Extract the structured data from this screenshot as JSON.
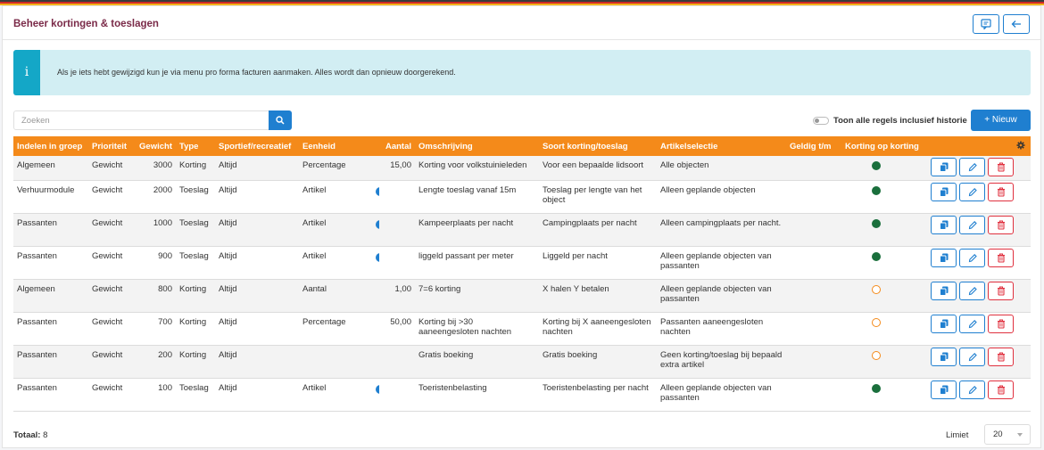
{
  "page": {
    "title": "Beheer kortingen & toeslagen",
    "header_icons": [
      "comment-icon",
      "arrow-left-icon"
    ]
  },
  "alert": {
    "icon": "i",
    "text": "Als je iets hebt gewijzigd kun je via menu pro forma facturen aanmaken. Alles wordt dan opnieuw doorgerekend."
  },
  "toolbar": {
    "search_placeholder": "Zoeken",
    "search_value": "",
    "toggle_label": "Toon alle regels inclusief historie",
    "toggle_on": false,
    "new_label": "+ Nieuw"
  },
  "table": {
    "columns": [
      "Indelen in groep",
      "Prioriteit",
      "Gewicht",
      "Type",
      "Sportief/recreatief",
      "Eenheid",
      "",
      "Aantal",
      "Omschrijving",
      "Soort korting/toeslag",
      "Artikelselectie",
      "Geldig t/m",
      "Korting op korting",
      ""
    ],
    "rows": [
      {
        "groep": "Algemeen",
        "prioriteit": "Gewicht",
        "gewicht": "3000",
        "type": "Korting",
        "sport": "Altijd",
        "eenheid": "Percentage",
        "info": false,
        "aantal": "15,00",
        "omschrijving": "Korting voor volkstuinieleden",
        "soort": "Voor een bepaalde lidsoort",
        "artikel": "Alle objecten",
        "geldig": "",
        "kok": true
      },
      {
        "groep": "Verhuurmodule",
        "prioriteit": "Gewicht",
        "gewicht": "2000",
        "type": "Toeslag",
        "sport": "Altijd",
        "eenheid": "Artikel",
        "info": true,
        "aantal": "",
        "omschrijving": "Lengte toeslag vanaf 15m",
        "soort": "Toeslag per lengte van het object",
        "artikel": "Alleen geplande objecten",
        "geldig": "",
        "kok": true
      },
      {
        "groep": "Passanten",
        "prioriteit": "Gewicht",
        "gewicht": "1000",
        "type": "Toeslag",
        "sport": "Altijd",
        "eenheid": "Artikel",
        "info": true,
        "aantal": "",
        "omschrijving": "Kampeerplaats per nacht",
        "soort": "Campingplaats per nacht",
        "artikel": "Alleen campingplaats per nacht.",
        "geldig": "",
        "kok": true
      },
      {
        "groep": "Passanten",
        "prioriteit": "Gewicht",
        "gewicht": "900",
        "type": "Toeslag",
        "sport": "Altijd",
        "eenheid": "Artikel",
        "info": true,
        "aantal": "",
        "omschrijving": "liggeld passant per meter",
        "soort": "Liggeld per nacht",
        "artikel": "Alleen geplande objecten van passanten",
        "geldig": "",
        "kok": true
      },
      {
        "groep": "Algemeen",
        "prioriteit": "Gewicht",
        "gewicht": "800",
        "type": "Korting",
        "sport": "Altijd",
        "eenheid": "Aantal",
        "info": false,
        "aantal": "1,00",
        "omschrijving": "7=6 korting",
        "soort": "X halen Y betalen",
        "artikel": "Alleen geplande objecten van passanten",
        "geldig": "",
        "kok": false
      },
      {
        "groep": "Passanten",
        "prioriteit": "Gewicht",
        "gewicht": "700",
        "type": "Korting",
        "sport": "Altijd",
        "eenheid": "Percentage",
        "info": false,
        "aantal": "50,00",
        "omschrijving": "Korting bij >30 aaneengesloten nachten",
        "soort": "Korting bij X aaneengesloten nachten",
        "artikel": "Passanten aaneengesloten nachten",
        "geldig": "",
        "kok": false
      },
      {
        "groep": "Passanten",
        "prioriteit": "Gewicht",
        "gewicht": "200",
        "type": "Korting",
        "sport": "Altijd",
        "eenheid": "",
        "info": false,
        "aantal": "",
        "omschrijving": "Gratis boeking",
        "soort": "Gratis boeking",
        "artikel": "Geen korting/toeslag bij bepaald extra artikel",
        "geldig": "",
        "kok": false
      },
      {
        "groep": "Passanten",
        "prioriteit": "Gewicht",
        "gewicht": "100",
        "type": "Toeslag",
        "sport": "Altijd",
        "eenheid": "Artikel",
        "info": true,
        "aantal": "",
        "omschrijving": "Toeristenbelasting",
        "soort": "Toeristenbelasting per nacht",
        "artikel": "Alleen geplande objecten van passanten",
        "geldig": "",
        "kok": true
      }
    ],
    "row_heights": [],
    "settings_icon": "gear-icon",
    "action_icons": [
      "copy-icon",
      "pencil-icon",
      "trash-icon"
    ]
  },
  "footer": {
    "total_label": "Totaal:",
    "total_value": "8",
    "limit_label": "Limiet",
    "limit_value": "20"
  },
  "colors": {
    "title": "#7a2a48",
    "primary": "#1f7fd0",
    "table_header": "#f48a1a",
    "alert_bg": "#d2eef3",
    "alert_icon": "#14a7c7",
    "status_on": "#1a6f3c",
    "status_off": "#f48a1a",
    "danger": "#e0313f"
  }
}
